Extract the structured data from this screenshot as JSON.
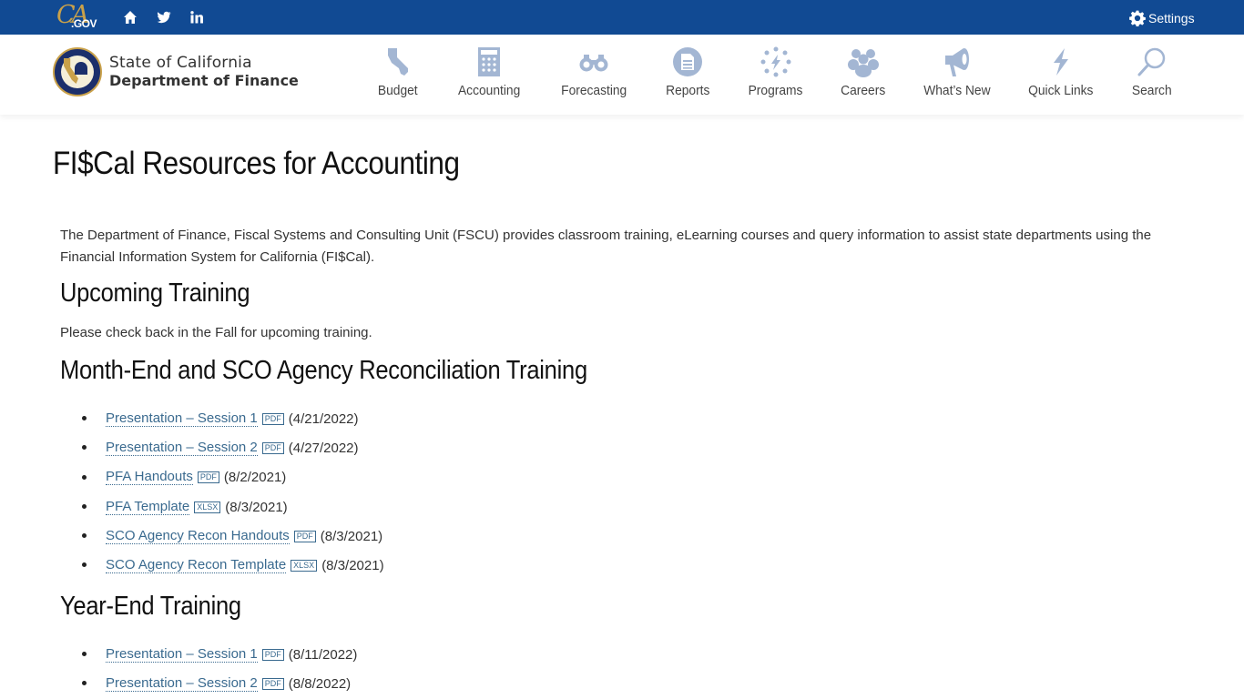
{
  "utility_bar": {
    "logo_ca": "CA",
    "logo_gov": ".GOV",
    "icons": [
      "home-icon",
      "twitter-icon",
      "linkedin-icon"
    ],
    "settings_label": "Settings"
  },
  "header": {
    "brand_line1": "State of California",
    "brand_line2": "Department of Finance",
    "nav": [
      {
        "label": "Budget",
        "icon": "california-icon"
      },
      {
        "label": "Accounting",
        "icon": "calculator-icon"
      },
      {
        "label": "Forecasting",
        "icon": "binoculars-icon"
      },
      {
        "label": "Reports",
        "icon": "report-icon"
      },
      {
        "label": "Programs",
        "icon": "programs-icon"
      },
      {
        "label": "Careers",
        "icon": "people-icon"
      },
      {
        "label": "What’s New",
        "icon": "megaphone-icon"
      },
      {
        "label": "Quick Links",
        "icon": "lightning-icon"
      },
      {
        "label": "Search",
        "icon": "search-icon"
      }
    ]
  },
  "main": {
    "title": "FI$Cal Resources for Accounting",
    "intro": "The Department of Finance, Fiscal Systems and Consulting Unit (FSCU) provides classroom training, eLearning courses and query information to assist state departments using the Financial Information System for California (FI$Cal).",
    "sections": [
      {
        "heading": "Upcoming Training",
        "text": "Please check back in the Fall for upcoming training."
      },
      {
        "heading": "Month-End and SCO Agency Reconciliation Training",
        "items": [
          {
            "label": "Presentation – Session 1",
            "type": "PDF",
            "date": "(4/21/2022)"
          },
          {
            "label": "Presentation – Session 2",
            "type": "PDF",
            "date": "(4/27/2022)"
          },
          {
            "label": "PFA Handouts",
            "type": "PDF",
            "date": "(8/2/2021)"
          },
          {
            "label": "PFA Template",
            "type": "XLSX",
            "date": "(8/3/2021)"
          },
          {
            "label": "SCO Agency Recon Handouts",
            "type": "PDF",
            "date": "(8/3/2021)"
          },
          {
            "label": "SCO Agency Recon Template",
            "type": "XLSX",
            "date": "(8/3/2021)"
          }
        ]
      },
      {
        "heading": "Year-End Training",
        "items": [
          {
            "label": "Presentation – Session 1",
            "type": "PDF",
            "date": "(8/11/2022)"
          },
          {
            "label": "Presentation – Session 2",
            "type": "PDF",
            "date": "(8/8/2022)"
          }
        ]
      }
    ]
  },
  "colors": {
    "utility_bar": "#114a93",
    "nav_icon": "#a3b6d3",
    "link": "#3a6a8f",
    "logo_gold": "#c9a14a"
  }
}
